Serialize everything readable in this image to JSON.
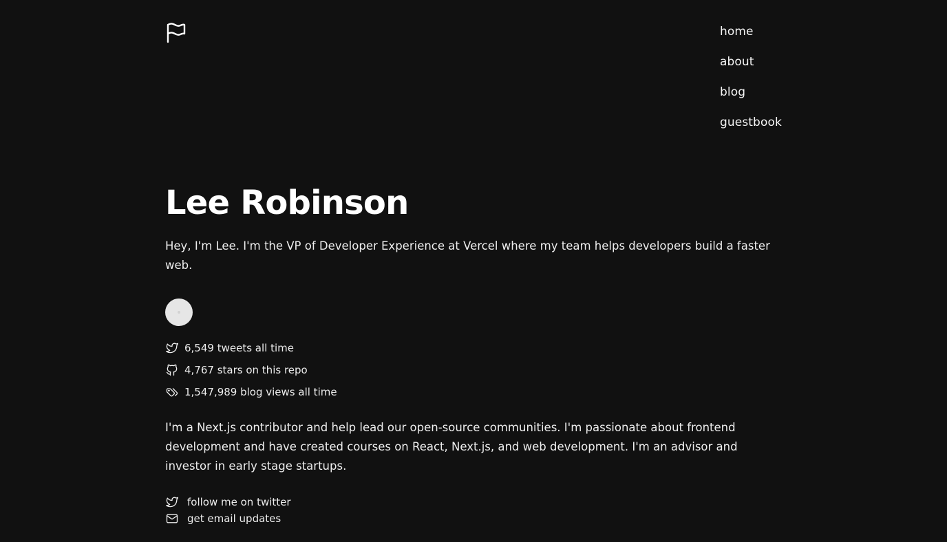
{
  "header": {
    "logo_icon": "flag-icon",
    "nav": [
      {
        "label": "home"
      },
      {
        "label": "about"
      },
      {
        "label": "blog"
      },
      {
        "label": "guestbook"
      }
    ]
  },
  "profile": {
    "name": "Lee Robinson",
    "intro": "Hey, I'm Lee. I'm the VP of Developer Experience at Vercel where my team helps developers build a faster web.",
    "avatar_icon": "avatar",
    "stats": [
      {
        "icon": "twitter-icon",
        "text": "6,549 tweets all time"
      },
      {
        "icon": "github-icon",
        "text": "4,767 stars on this repo"
      },
      {
        "icon": "tags-icon",
        "text": "1,547,989 blog views all time"
      }
    ],
    "bio": "I'm a Next.js contributor and help lead our open-source communities. I'm passionate about frontend development and have created courses on React, Next.js, and web development. I'm an advisor and investor in early stage startups.",
    "links": [
      {
        "icon": "twitter-icon",
        "label": "follow me on twitter"
      },
      {
        "icon": "mail-icon",
        "label": "get email updates"
      }
    ]
  },
  "colors": {
    "background": "#111111",
    "text": "#ededed",
    "heading": "#ffffff"
  }
}
